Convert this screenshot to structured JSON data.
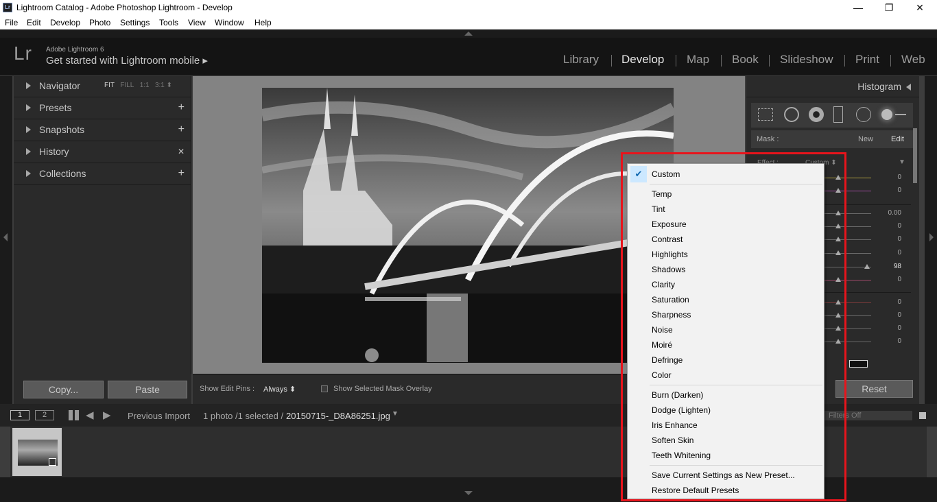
{
  "window": {
    "title": "Lightroom Catalog - Adobe Photoshop Lightroom - Develop",
    "icon": "lr-app-icon"
  },
  "menubar": [
    "File",
    "Edit",
    "Develop",
    "Photo",
    "Settings",
    "Tools",
    "View",
    "Window",
    "Help"
  ],
  "identity": {
    "logo": "Lr",
    "product": "Adobe Lightroom 6",
    "promo": "Get started with Lightroom mobile ▸"
  },
  "modules": [
    "Library",
    "Develop",
    "Map",
    "Book",
    "Slideshow",
    "Print",
    "Web"
  ],
  "left_panel": {
    "navigator": {
      "label": "Navigator",
      "options": [
        "FIT",
        "FILL",
        "1:1",
        "3:1 ⬍"
      ]
    },
    "presets": {
      "label": "Presets",
      "action": "+"
    },
    "snapshots": {
      "label": "Snapshots",
      "action": "+"
    },
    "history": {
      "label": "History",
      "action": "✕"
    },
    "collections": {
      "label": "Collections",
      "action": "+"
    },
    "copy_label": "Copy...",
    "paste_label": "Paste"
  },
  "toolbar": {
    "pins_label": "Show Edit Pins :",
    "pins_value": "Always ⬍",
    "overlay_label": "Show Selected Mask Overlay"
  },
  "right_panel": {
    "histogram_label": "Histogram",
    "mask_label": "Mask :",
    "mask_new": "New",
    "mask_edit": "Edit",
    "effect_label": "Effect :",
    "effect_value": "Custom ⬍",
    "slider_values": [
      "0",
      "0",
      "0.00",
      "0",
      "0",
      "0",
      "98",
      "0",
      "0",
      "0",
      "0",
      "0"
    ],
    "reset_label": "Reset"
  },
  "filmstrip": {
    "page1": "1",
    "page2": "2",
    "source": "Previous Import",
    "count": "1 photo /1 selected /",
    "filename": "20150715-_D8A86251.jpg",
    "filter": "Filters Off"
  },
  "context_menu": {
    "checked": "Custom",
    "group1": [
      "Temp",
      "Tint",
      "Exposure",
      "Contrast",
      "Highlights",
      "Shadows",
      "Clarity",
      "Saturation",
      "Sharpness",
      "Noise",
      "Moiré",
      "Defringe",
      "Color"
    ],
    "group2": [
      "Burn (Darken)",
      "Dodge (Lighten)",
      "Iris Enhance",
      "Soften Skin",
      "Teeth Whitening"
    ],
    "group3": [
      "Save Current Settings as New Preset...",
      "Restore Default Presets"
    ]
  },
  "colors": {
    "highlight_box": "#e8141c",
    "panel": "#2a2a2a",
    "canvas": "#838383"
  }
}
